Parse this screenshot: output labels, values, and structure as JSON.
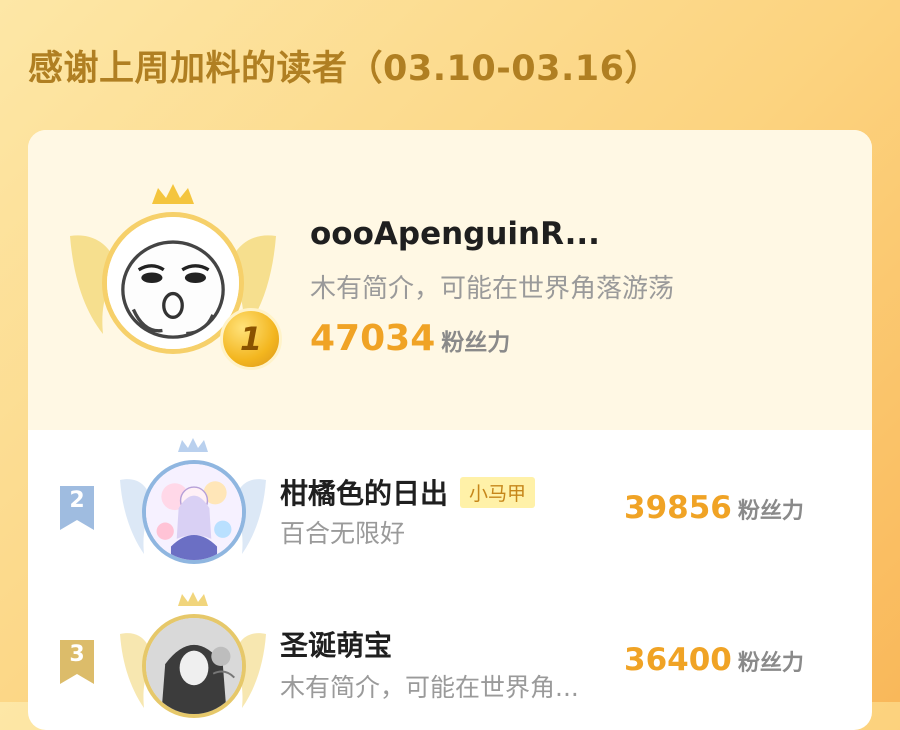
{
  "header": {
    "title": "感谢上周加料的读者（03.10-03.16）"
  },
  "ranking": [
    {
      "rank": "1",
      "name": "oooApenguinR...",
      "bio": "木有简介，可能在世界角落游荡",
      "fans_value": "47034",
      "fans_label": "粉丝力",
      "avatar_icon": "cartoon-face-avatar",
      "accent": "#f6d06a"
    },
    {
      "rank": "2",
      "name": "柑橘色的日出",
      "tag": "小马甲",
      "bio": "百合无限好",
      "fans_value": "39856",
      "fans_label": "粉丝力",
      "avatar_icon": "anime-girl-avatar",
      "accent": "#8fb6e0"
    },
    {
      "rank": "3",
      "name": "圣诞萌宝",
      "bio": "木有简介，可能在世界角...",
      "fans_value": "36400",
      "fans_label": "粉丝力",
      "avatar_icon": "photo-avatar",
      "accent": "#e6c86a"
    }
  ],
  "colors": {
    "title": "#b07f22",
    "fans_value": "#f0a325",
    "tag_background": "#fff1a8",
    "tag_text": "#c6861a"
  }
}
